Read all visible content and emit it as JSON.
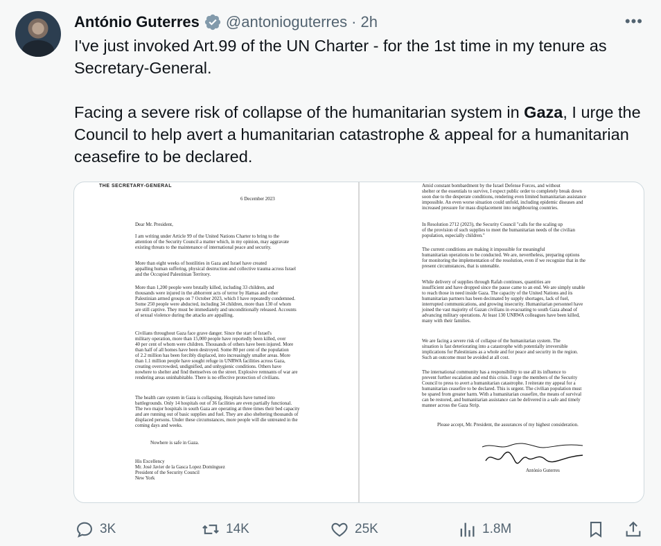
{
  "author": {
    "name": "António Guterres",
    "handle": "@antonioguterres",
    "separator": "·",
    "time": "2h"
  },
  "tweet": {
    "para1": "I've just invoked Art.99 of the UN Charter - for the 1st time in my tenure as Secretary-General.",
    "para2_before": "Facing a severe risk of collapse of the humanitarian system in ",
    "para2_bold": "Gaza",
    "para2_after": ", I urge the Council to help avert a humanitarian catastrophe & appeal for a humanitarian ceasefire to be declared."
  },
  "letter": {
    "letterhead": "THE SECRETARY-GENERAL",
    "date": "6 December 2023",
    "left_paras": [
      "Dear Mr. President,",
      "I am writing under Article 99 of the United Nations Charter to bring to the\nattention of the Security Council a matter which, in my opinion, may aggravate\nexisting threats to the maintenance of international peace and security.",
      "More than eight weeks of hostilities in Gaza and Israel have created\nappalling human suffering, physical destruction and collective trauma across Israel\nand the Occupied Palestinian Territory.",
      "More than 1,200 people were brutally killed, including 33 children, and\nthousands were injured in the abhorrent acts of terror by Hamas and other\nPalestinian armed groups on 7 October 2023, which I have repeatedly condemned.\nSome 250 people were abducted, including 34 children, more than 130 of whom\nare still captive. They must be immediately and unconditionally released. Accounts\nof sexual violence during the attacks are appalling.",
      "Civilians throughout Gaza face grave danger. Since the start of Israel's\nmilitary operation, more than 15,000 people have reportedly been killed, over\n40 per cent of whom were children. Thousands of others have been injured. More\nthan half of all homes have been destroyed. Some 80 per cent of the population\nof 2.2 million has been forcibly displaced, into increasingly smaller areas. More\nthan 1.1 million people have sought refuge in UNRWA facilities across Gaza,\ncreating overcrowded, undignified, and unhygienic conditions. Others have\nnowhere to shelter and find themselves on the street. Explosive remnants of war are\nrendering areas uninhabitable. There is no effective protection of civilians.",
      "The health care system in Gaza is collapsing. Hospitals have turned into\nbattlegrounds. Only 14 hospitals out of 36 facilities are even partially functional.\nThe two major hospitals in south Gaza are operating at three times their bed capacity\nand are running out of basic supplies and fuel. They are also sheltering thousands of\ndisplaced persons. Under these circumstances, more people will die untreated in the\ncoming days and weeks.",
      "Nowhere is safe in Gaza.",
      "His Excellency\nMr. José Javier de la Gasca Lopez Domínguez\nPresident of the Security Council\nNew York"
    ],
    "right_paras": [
      "Amid constant bombardment by the Israel Defense Forces, and without\nshelter or the essentials to survive, I expect public order to completely break down\nsoon due to the desperate conditions, rendering even limited humanitarian assistance\nimpossible. An even worse situation could unfold, including epidemic diseases and\nincreased pressure for mass displacement into neighbouring countries.",
      "In Resolution 2712 (2023), the Security Council \"calls for the scaling up\nof the provision of such supplies to meet the humanitarian needs of the civilian\npopulation, especially children.\"",
      "The current conditions are making it impossible for meaningful\nhumanitarian operations to be conducted. We are, nevertheless, preparing options\nfor monitoring the implementation of the resolution, even if we recognize that in the\npresent circumstances, that is untenable.",
      "While delivery of supplies through Rafah continues, quantities are\ninsufficient and have dropped since the pause came to an end. We are simply unable\nto reach those in need inside Gaza. The capacity of the United Nations and its\nhumanitarian partners has been decimated by supply shortages, lack of fuel,\ninterrupted communications, and growing insecurity. Humanitarian personnel have\njoined the vast majority of Gazan civilians in evacuating to south Gaza ahead of\nadvancing military operations. At least 130 UNRWA colleagues have been killed,\nmany with their families.",
      "We are facing a severe risk of collapse of the humanitarian system. The\nsituation is fast deteriorating into a catastrophe with potentially irreversible\nimplications for Palestinians as a whole and for peace and security in the region.\nSuch an outcome must be avoided at all cost.",
      "The international community has a responsibility to use all its influence to\nprevent further escalation and end this crisis. I urge the members of the Security\nCouncil to press to avert a humanitarian catastrophe. I reiterate my appeal for a\nhumanitarian ceasefire to be declared. This is urgent. The civilian population must\nbe spared from greater harm. With a humanitarian ceasefire, the means of survival\ncan be restored, and humanitarian assistance can be delivered in a safe and timely\nmanner across the Gaza Strip.",
      "Please accept, Mr. President, the assurances of my highest consideration.",
      "António Guterres"
    ]
  },
  "actions": {
    "replies": "3K",
    "reposts": "14K",
    "likes": "25K",
    "views": "1.8M"
  },
  "icons": {
    "verified": "verified-badge-icon",
    "more": "more-options-icon",
    "reply": "reply-icon",
    "repost": "repost-icon",
    "like": "heart-icon",
    "views": "views-icon",
    "bookmark": "bookmark-icon",
    "share": "share-icon"
  },
  "colors": {
    "background": "#f7f8f8",
    "text": "#0f1419",
    "muted": "#536471",
    "verified": "#829aab"
  }
}
